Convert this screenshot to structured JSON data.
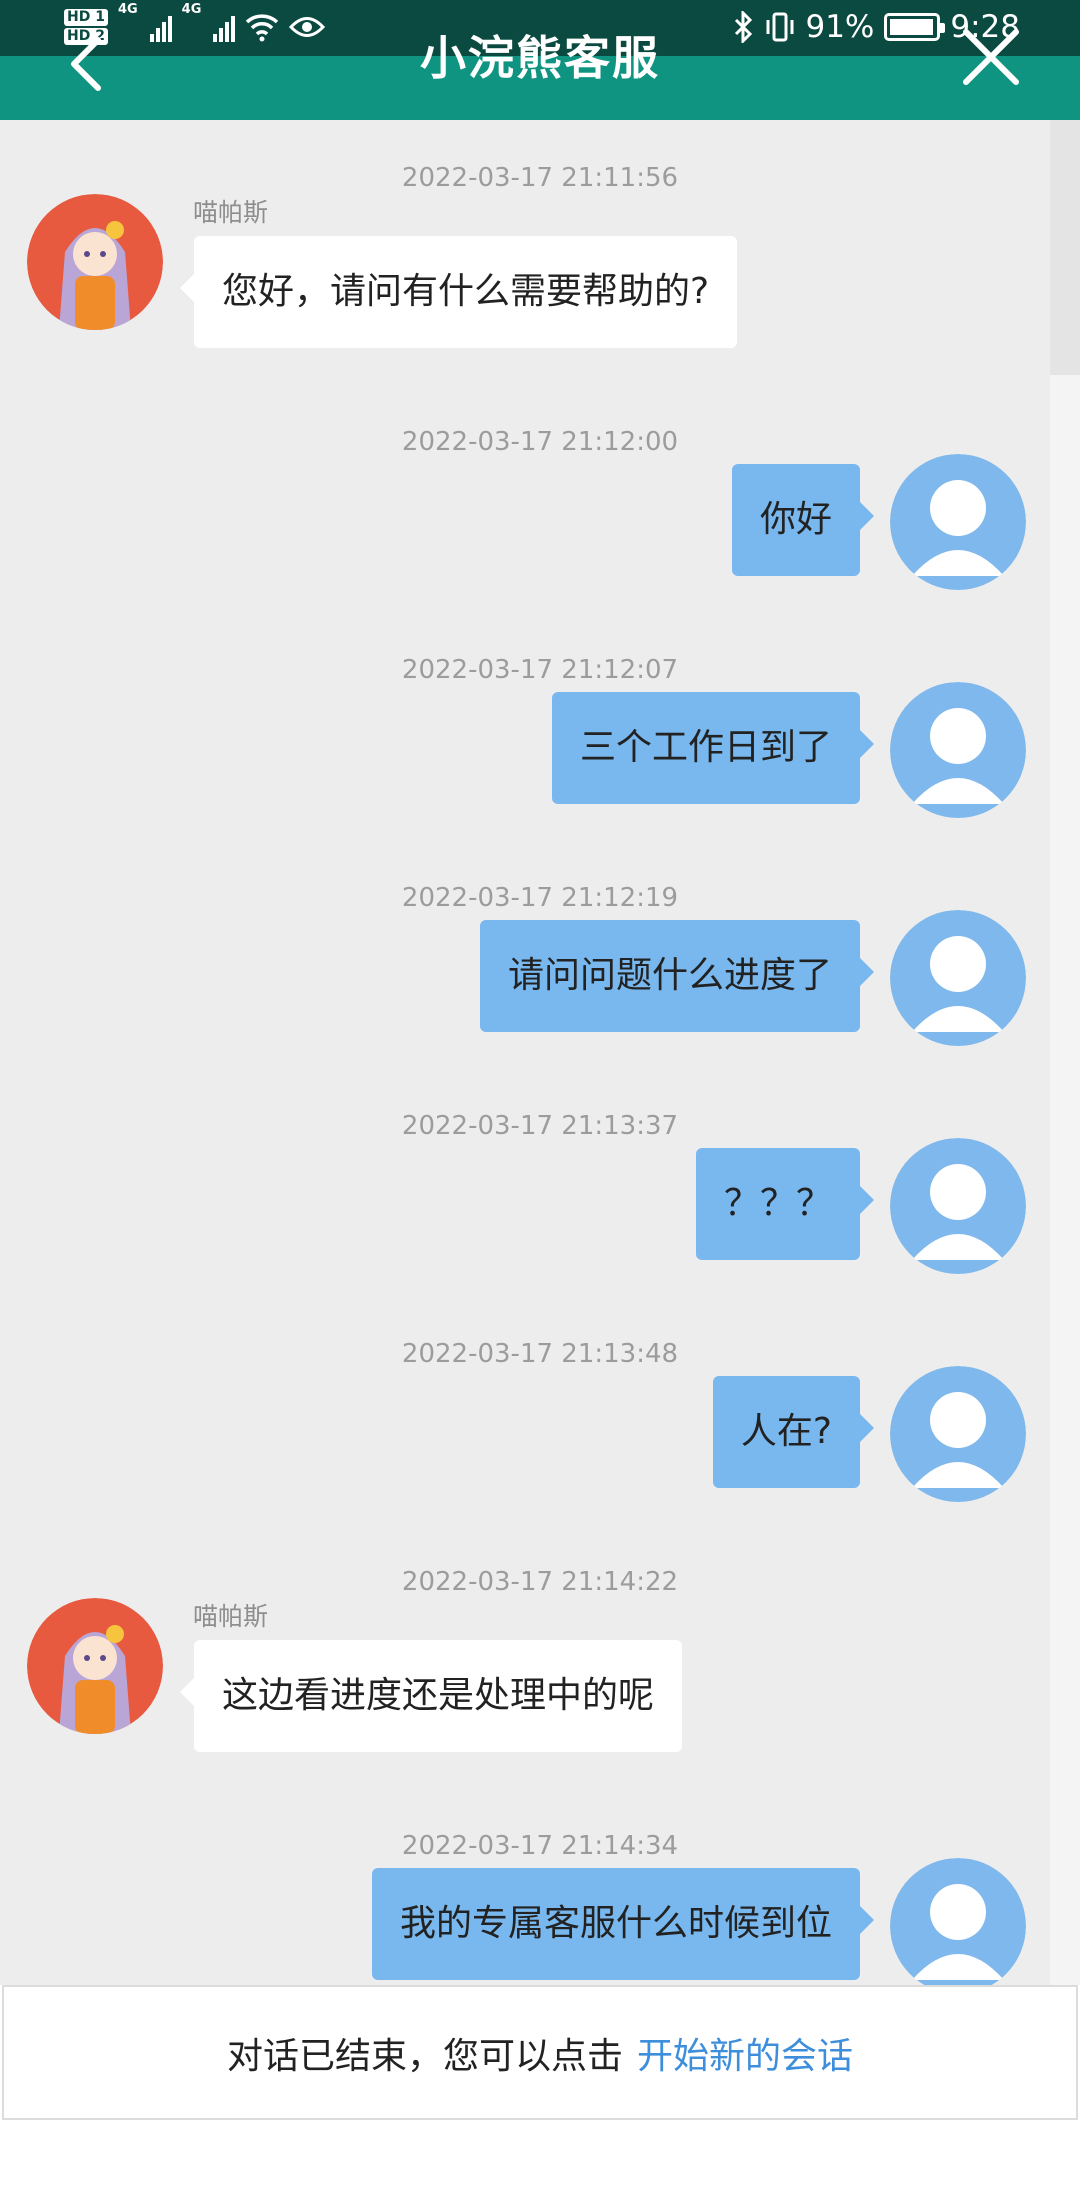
{
  "status_bar": {
    "hd1": "HD 1",
    "hd2": "HD 2",
    "sig1_label": "4G",
    "sig2_label": "4G",
    "battery_pct": "91%",
    "time": "9:28"
  },
  "header": {
    "title": "小浣熊客服",
    "back_icon": "chevron-left-icon",
    "close_icon": "close-icon",
    "bg_color": "#0f9481"
  },
  "messages": [
    {
      "timestamp": "2022-03-17 21:11:56",
      "side": "left",
      "sender": "喵帕斯",
      "text": "您好，请问有什么需要帮助的?"
    },
    {
      "timestamp": "2022-03-17 21:12:00",
      "side": "right",
      "text": "你好"
    },
    {
      "timestamp": "2022-03-17 21:12:07",
      "side": "right",
      "text": "三个工作日到了"
    },
    {
      "timestamp": "2022-03-17 21:12:19",
      "side": "right",
      "text": "请问问题什么进度了"
    },
    {
      "timestamp": "2022-03-17 21:13:37",
      "side": "right",
      "text": "？？？"
    },
    {
      "timestamp": "2022-03-17 21:13:48",
      "side": "right",
      "text": "人在?"
    },
    {
      "timestamp": "2022-03-17 21:14:22",
      "side": "left",
      "sender": "喵帕斯",
      "text": "这边看进度还是处理中的呢"
    },
    {
      "timestamp": "2022-03-17 21:14:34",
      "side": "right",
      "text": "我的专属客服什么时候到位"
    }
  ],
  "footer": {
    "text": "对话已结束，您可以点击",
    "link": "开始新的会话",
    "link_color": "#3d8edb"
  },
  "colors": {
    "user_bubble": "#78b8ee",
    "agent_bubble": "#ffffff",
    "chat_bg": "#ededed"
  }
}
